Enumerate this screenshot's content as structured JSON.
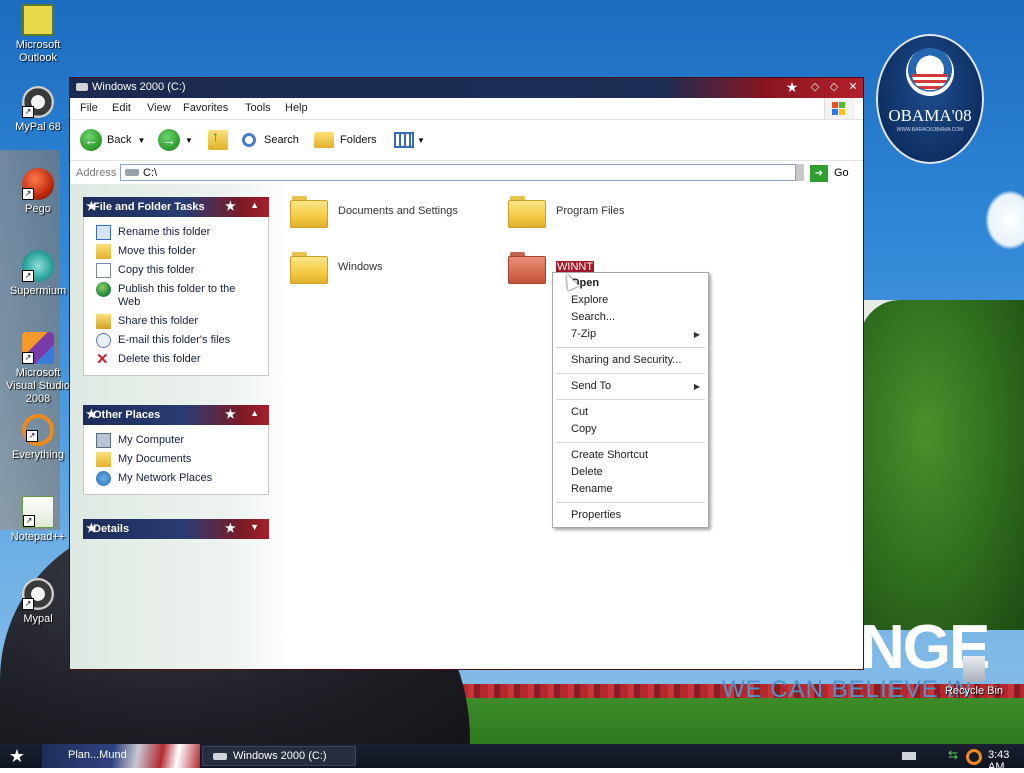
{
  "desktop": {
    "icons": [
      {
        "label": "Microsoft Outlook"
      },
      {
        "label": "MyPal 68"
      },
      {
        "label": "Pego"
      },
      {
        "label": "Supermium"
      },
      {
        "label": "Microsoft Visual Studio 2008"
      },
      {
        "label": "Everything"
      },
      {
        "label": "Notepad++"
      },
      {
        "label": "Mypal"
      }
    ],
    "recycle_bin": "Recycle Bin",
    "wallpaper": {
      "badge_text": "OBAMA'08",
      "badge_subtext": "WWW.BARACKOBAMA.COM",
      "slogan_big": "NGE",
      "slogan_small": "WE CAN BELIEVE IN"
    }
  },
  "window": {
    "title": "Windows 2000 (C:)",
    "menu": [
      "File",
      "Edit",
      "View",
      "Favorites",
      "Tools",
      "Help"
    ],
    "toolbar": {
      "back": "Back",
      "search": "Search",
      "folders": "Folders"
    },
    "address": {
      "label": "Address",
      "value": "C:\\",
      "go": "Go"
    },
    "panels": {
      "file_tasks": {
        "title": "File and Folder Tasks",
        "items": [
          "Rename this folder",
          "Move this folder",
          "Copy this folder",
          "Publish this folder to the Web",
          "Share this folder",
          "E-mail this folder's files",
          "Delete this folder"
        ]
      },
      "other_places": {
        "title": "Other Places",
        "items": [
          "My Computer",
          "My Documents",
          "My Network Places"
        ]
      },
      "details": {
        "title": "Details"
      }
    },
    "folders": [
      {
        "name": "Documents and Settings"
      },
      {
        "name": "Program Files"
      },
      {
        "name": "Windows"
      },
      {
        "name": "WINNT"
      }
    ]
  },
  "context_menu": {
    "items": [
      {
        "label": "Open"
      },
      {
        "label": "Explore"
      },
      {
        "label": "Search..."
      },
      {
        "label": "7-Zip"
      },
      {
        "label": "Sharing and Security..."
      },
      {
        "label": "Send To"
      },
      {
        "label": "Cut"
      },
      {
        "label": "Copy"
      },
      {
        "label": "Create Shortcut"
      },
      {
        "label": "Delete"
      },
      {
        "label": "Rename"
      },
      {
        "label": "Properties"
      }
    ]
  },
  "taskbar": {
    "quick_item": "Plan...Mund",
    "window_button": "Windows 2000 (C:)",
    "clock": "3:43 AM"
  }
}
